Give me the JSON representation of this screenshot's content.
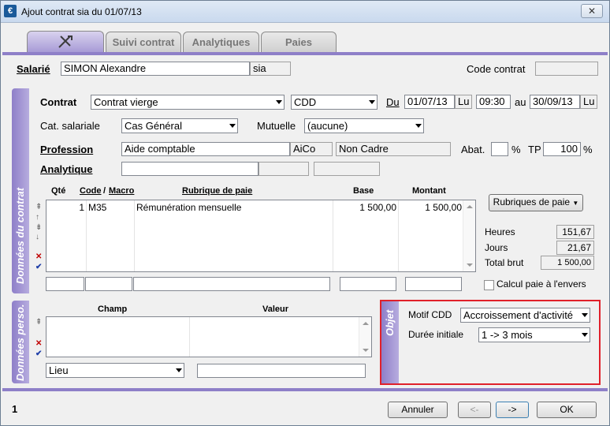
{
  "window": {
    "title": "Ajout contrat sia du 01/07/13",
    "close_label": "✕",
    "app_icon": "€"
  },
  "tabs": [
    {
      "label": "",
      "icon": "tools-icon"
    },
    {
      "label": "Suivi contrat"
    },
    {
      "label": "Analytiques"
    },
    {
      "label": "Paies"
    }
  ],
  "header": {
    "salarie_label": "Salarié",
    "salarie_value": "SIMON Alexandre",
    "salarie_code": "sia",
    "code_contrat_label": "Code contrat",
    "code_contrat_value": ""
  },
  "contrat_section": {
    "side_title": "Données du contrat",
    "contrat_label": "Contrat",
    "contrat_value": "Contrat vierge",
    "type_value": "CDD",
    "du_label": "Du",
    "date_from": "01/07/13",
    "day_from": "Lu",
    "time_from": "09:30",
    "au_label": "au",
    "date_to": "30/09/13",
    "day_to": "Lu",
    "cat_label": "Cat. salariale",
    "cat_value": "Cas Général",
    "mutuelle_label": "Mutuelle",
    "mutuelle_value": "(aucune)",
    "profession_label": "Profession",
    "profession_value": "Aide comptable",
    "profession_code": "AiCo",
    "profession_status": "Non Cadre",
    "abat_label": "Abat.",
    "abat_value": "",
    "percent1": "%",
    "tp_label": "TP",
    "tp_value": "100",
    "percent2": "%",
    "analytique_label": "Analytique"
  },
  "rubriques_table": {
    "headers": {
      "qte": "Qté",
      "code": "Code",
      "slash": "/",
      "macro": "Macro",
      "rubrique": "Rubrique de paie",
      "base": "Base",
      "montant": "Montant"
    },
    "rows": [
      {
        "qte": "1",
        "code": "M35",
        "rubrique": "Rémunération mensuelle",
        "base": "1 500,00",
        "montant": "1 500,00"
      }
    ],
    "button_label": "Rubriques de paie"
  },
  "totaux": {
    "heures_label": "Heures",
    "heures_value": "151,67",
    "jours_label": "Jours",
    "jours_value": "21,67",
    "total_label": "Total brut",
    "total_value": "1 500,00",
    "calcul_label": "Calcul paie à l'envers"
  },
  "perso_section": {
    "side_title": "Données perso.",
    "champ_header": "Champ",
    "valeur_header": "Valeur",
    "lieu_value": "Lieu",
    "valeur_input": ""
  },
  "objet_section": {
    "side_title": "Objet",
    "motif_label": "Motif CDD",
    "motif_value": "Accroissement d'activité",
    "duree_label": "Durée initiale",
    "duree_value": "1 -> 3 mois"
  },
  "footer": {
    "page_number": "1",
    "annuler_label": "Annuler",
    "prev_label": "<-",
    "next_label": "->",
    "ok_label": "OK"
  }
}
